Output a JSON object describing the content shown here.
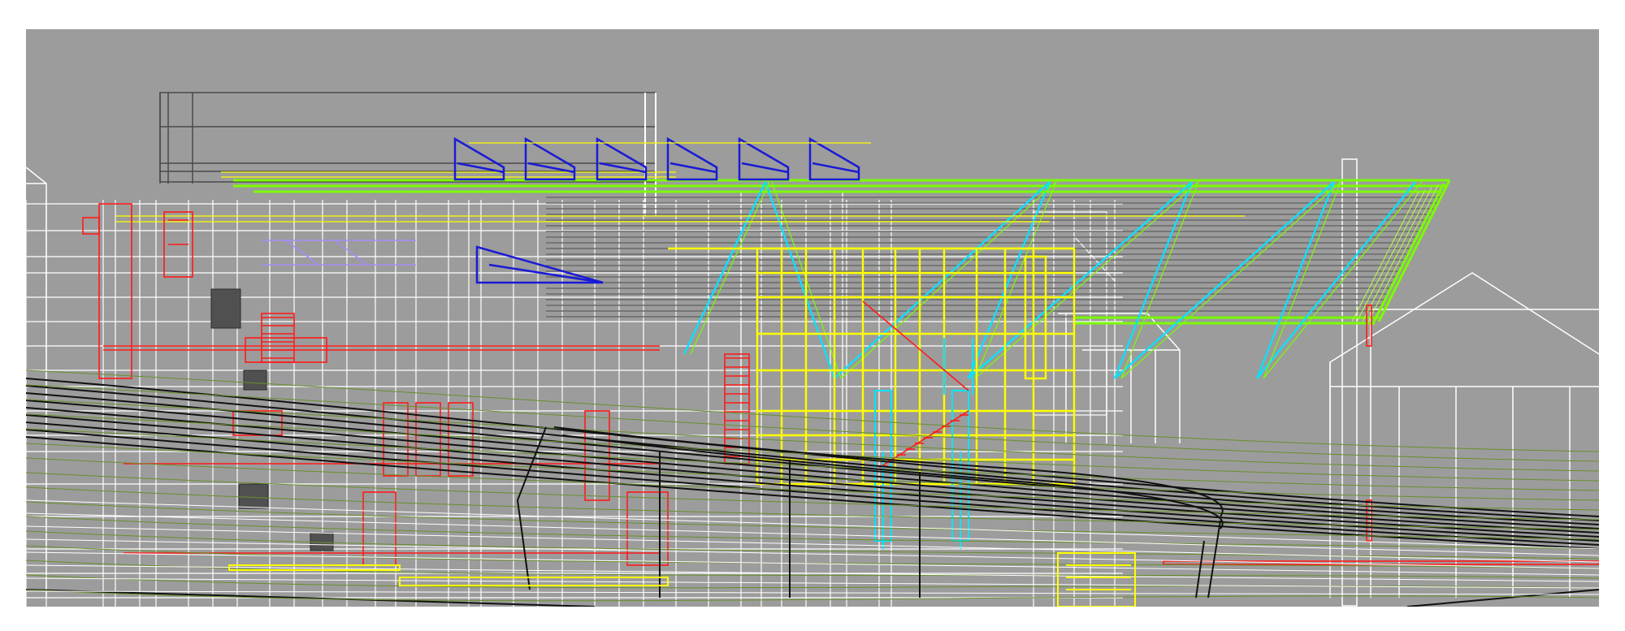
{
  "viewport": {
    "background": "#9c9c9c",
    "render_mode": "wireframe",
    "view": "elevation"
  },
  "layer_colors": {
    "structure": "#ffffff",
    "roof_truss": "#7cfc00",
    "truss_diagonal": "#00e5ff",
    "clerestory": "#1a1ad6",
    "framing": "#ffff00",
    "stairs": "#ff0000",
    "terrain": "#000000",
    "vegetation": "#6a8f2a"
  }
}
